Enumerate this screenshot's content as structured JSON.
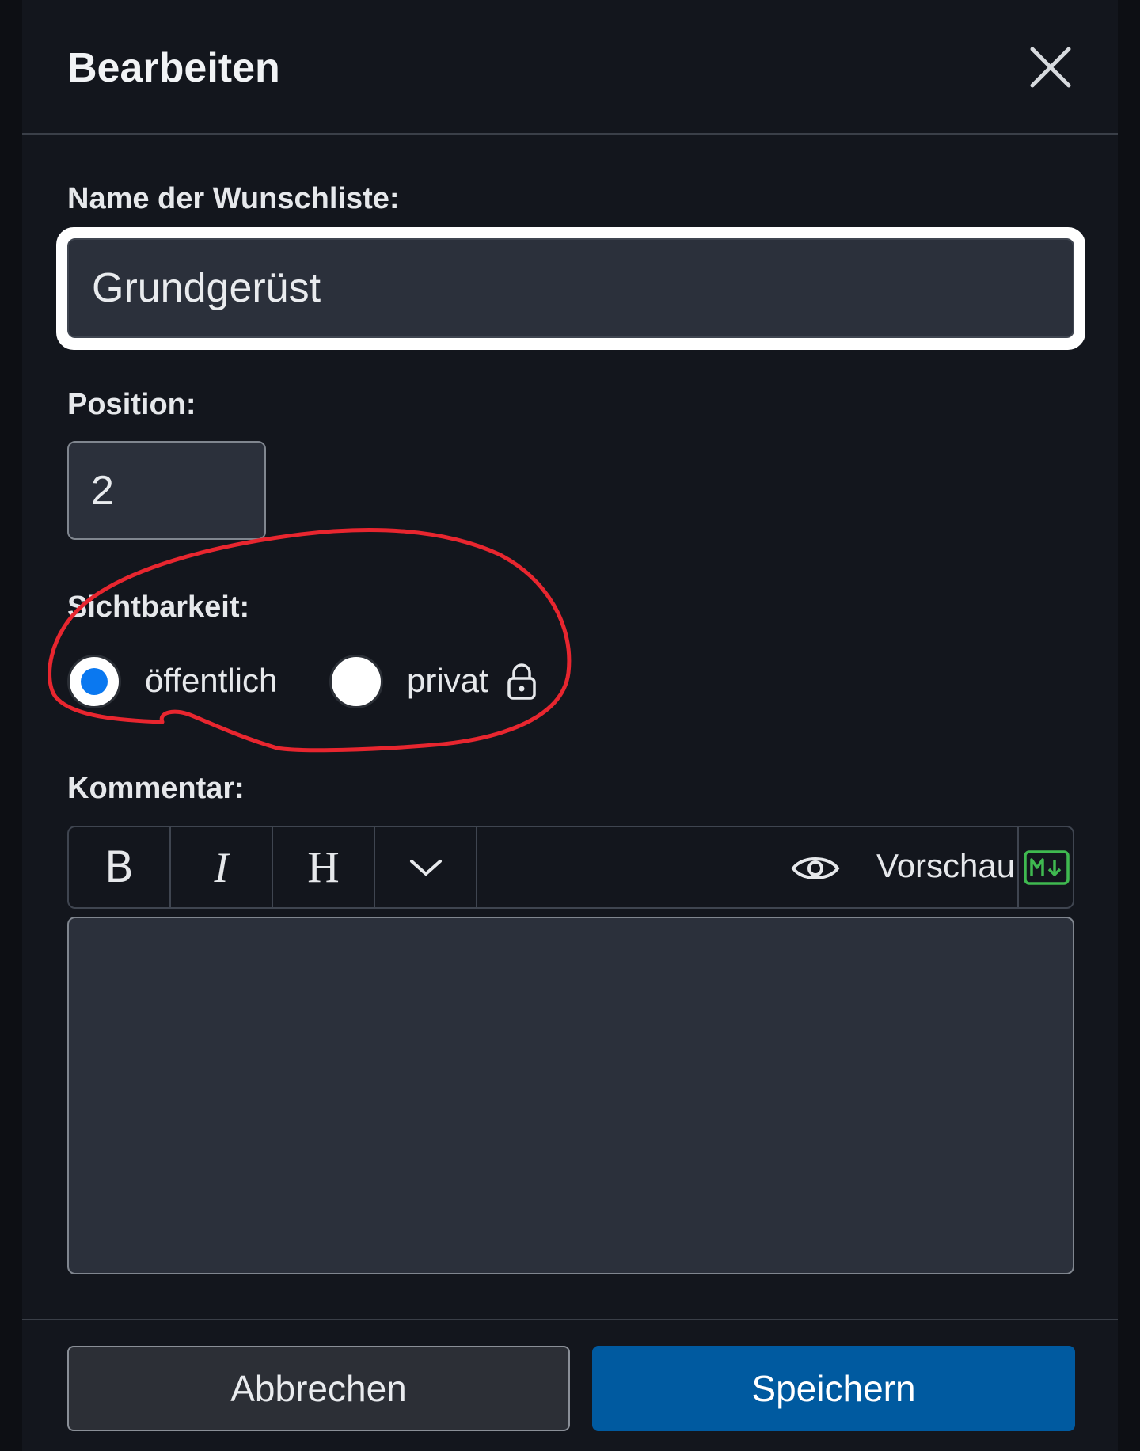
{
  "dialog": {
    "title": "Bearbeiten"
  },
  "form": {
    "name_label": "Name der Wunschliste:",
    "name_value": "Grundgerüst",
    "position_label": "Position:",
    "position_value": "2",
    "visibility_label": "Sichtbarkeit:",
    "visibility_options": [
      {
        "label": "öffentlich",
        "selected": true
      },
      {
        "label": "privat",
        "selected": false,
        "icon": "lock-icon"
      }
    ],
    "comment_label": "Kommentar:",
    "comment_value": ""
  },
  "editor_toolbar": {
    "bold": "B",
    "italic": "I",
    "heading": "H",
    "more_icon": "chevron-down-icon",
    "preview_label": "Vorschau",
    "preview_icon": "eye-icon",
    "markdown_icon": "markdown-icon"
  },
  "footer": {
    "cancel_label": "Abbrechen",
    "save_label": "Speichern"
  },
  "colors": {
    "background": "#13161d",
    "input_bg": "#2b303b",
    "primary": "#005aa0",
    "radio_selected": "#0a78f0",
    "markdown_green": "#3fb950",
    "annotation_red": "#e8262f"
  }
}
